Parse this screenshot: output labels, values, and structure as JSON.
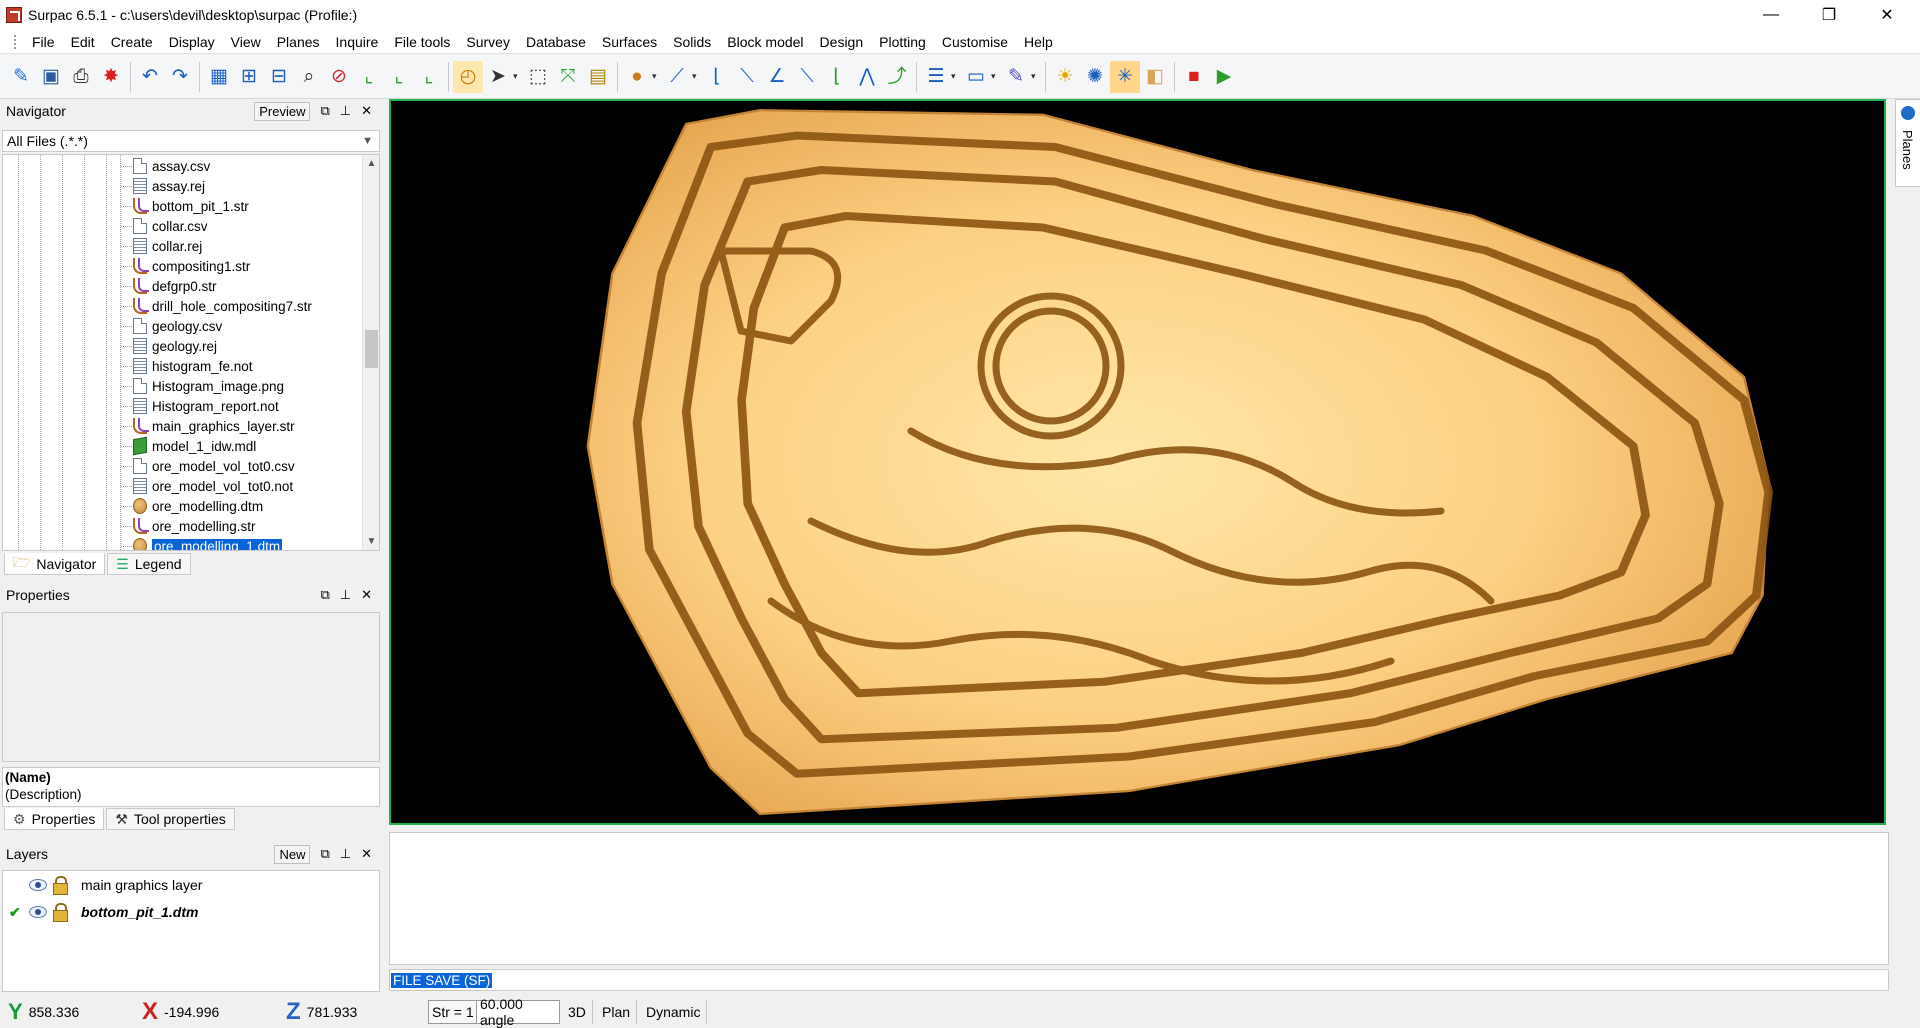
{
  "window": {
    "title": "Surpac 6.5.1 - c:\\users\\devil\\desktop\\surpac (Profile:)",
    "minimize": "—",
    "restore": "❐",
    "close": "✕"
  },
  "menu": [
    "File",
    "Edit",
    "Create",
    "Display",
    "View",
    "Planes",
    "Inquire",
    "File tools",
    "Survey",
    "Database",
    "Surfaces",
    "Solids",
    "Block model",
    "Design",
    "Plotting",
    "Customise",
    "Help"
  ],
  "toolbar_icons": [
    "new-icon",
    "save-icon",
    "print-icon",
    "close-layer-icon",
    "undo-icon",
    "redo-icon",
    "grid-icon",
    "zoom-in-icon",
    "zoom-out-icon",
    "zoom-box-icon",
    "recall-icon",
    "axis-x-icon",
    "axis-y-icon",
    "axis-z-icon",
    "rotate-icon",
    "select-icon",
    "select-box-icon",
    "move-point-icon",
    "image-icon",
    "point-icon",
    "cursor-icon",
    "segment-icon",
    "line-icon",
    "angle-icon",
    "segment-point-icon",
    "trim-icon",
    "polyline-icon",
    "add-point-icon",
    "menu-icon",
    "display-icon",
    "pen-icon",
    "light-icon",
    "shade-icon",
    "wireframe-icon",
    "solid-icon",
    "record-icon",
    "play-icon"
  ],
  "navigator": {
    "title": "Navigator",
    "preview_label": "Preview",
    "filter": "All Files (.*.*)",
    "files": [
      {
        "name": "assay.csv",
        "type": "doc"
      },
      {
        "name": "assay.rej",
        "type": "not"
      },
      {
        "name": "bottom_pit_1.str",
        "type": "str"
      },
      {
        "name": "collar.csv",
        "type": "doc"
      },
      {
        "name": "collar.rej",
        "type": "not"
      },
      {
        "name": "compositing1.str",
        "type": "str"
      },
      {
        "name": "defgrp0.str",
        "type": "str"
      },
      {
        "name": "drill_hole_compositing7.str",
        "type": "str"
      },
      {
        "name": "geology.csv",
        "type": "doc"
      },
      {
        "name": "geology.rej",
        "type": "not"
      },
      {
        "name": "histogram_fe.not",
        "type": "not"
      },
      {
        "name": "Histogram_image.png",
        "type": "doc"
      },
      {
        "name": "Histogram_report.not",
        "type": "not"
      },
      {
        "name": "main_graphics_layer.str",
        "type": "str"
      },
      {
        "name": "model_1_idw.mdl",
        "type": "mdl"
      },
      {
        "name": "ore_model_vol_tot0.csv",
        "type": "doc"
      },
      {
        "name": "ore_model_vol_tot0.not",
        "type": "not"
      },
      {
        "name": "ore_modelling.dtm",
        "type": "dtm"
      },
      {
        "name": "ore_modelling.str",
        "type": "str"
      },
      {
        "name": "ore_modelling_1.dtm",
        "type": "dtm",
        "selected": true
      }
    ],
    "tabs": [
      "Navigator",
      "Legend"
    ]
  },
  "properties": {
    "title": "Properties",
    "name_label": "(Name)",
    "description_label": "(Description)",
    "tabs": [
      "Properties",
      "Tool properties"
    ]
  },
  "layers": {
    "title": "Layers",
    "new_label": "New",
    "items": [
      {
        "name": "main graphics layer",
        "active": false
      },
      {
        "name": "bottom_pit_1.dtm",
        "active": true
      }
    ]
  },
  "planes_dock_label": "Planes",
  "command_line": "FILE SAVE (SF)",
  "status": {
    "y_value": "858.336",
    "x_value": "-194.996",
    "z_value": "781.933",
    "str_label": "Str = 1",
    "angle_label": "60.000 angle",
    "mode_3d": "3D",
    "plan": "Plan",
    "dynamic": "Dynamic"
  },
  "colors": {
    "viewport_border": "#22b14c",
    "surface_light": "#ffd98a",
    "surface_dark": "#b36f1c",
    "selection": "#0a64d8"
  }
}
